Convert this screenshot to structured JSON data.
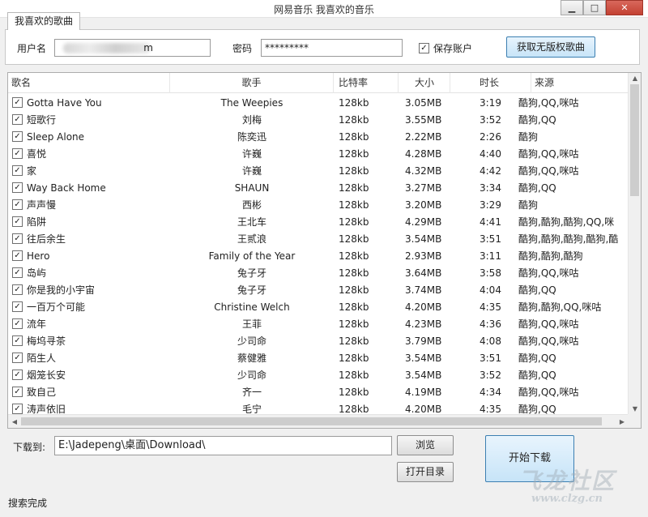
{
  "window": {
    "title": "网易音乐 我喜欢的音乐",
    "minimize_glyph": "▁",
    "maximize_glyph": "□",
    "close_glyph": "✕"
  },
  "tab": {
    "label": "我喜欢的歌曲"
  },
  "login": {
    "username_label": "用户名",
    "username_value_suffix": "m",
    "password_label": "密码",
    "password_value": "*********",
    "save_account_label": "保存账户",
    "save_account_checked": true,
    "fetch_button": "获取无版权歌曲"
  },
  "table": {
    "headers": [
      "歌名",
      "歌手",
      "比特率",
      "大小",
      "时长",
      "来源"
    ],
    "rows": [
      {
        "title": "Gotta Have You",
        "artist": "The Weepies",
        "bitrate": "128kb",
        "size": "3.05MB",
        "duration": "3:19",
        "source": "酷狗,QQ,咪咕"
      },
      {
        "title": "短歌行",
        "artist": "刘梅",
        "bitrate": "128kb",
        "size": "3.55MB",
        "duration": "3:52",
        "source": "酷狗,QQ"
      },
      {
        "title": "Sleep Alone",
        "artist": "陈奕迅",
        "bitrate": "128kb",
        "size": "2.22MB",
        "duration": "2:26",
        "source": "酷狗"
      },
      {
        "title": "喜悦",
        "artist": "许巍",
        "bitrate": "128kb",
        "size": "4.28MB",
        "duration": "4:40",
        "source": "酷狗,QQ,咪咕"
      },
      {
        "title": "家",
        "artist": "许巍",
        "bitrate": "128kb",
        "size": "4.32MB",
        "duration": "4:42",
        "source": "酷狗,QQ,咪咕"
      },
      {
        "title": "Way Back Home",
        "artist": "SHAUN",
        "bitrate": "128kb",
        "size": "3.27MB",
        "duration": "3:34",
        "source": "酷狗,QQ"
      },
      {
        "title": "声声慢",
        "artist": "西彬",
        "bitrate": "128kb",
        "size": "3.20MB",
        "duration": "3:29",
        "source": "酷狗"
      },
      {
        "title": "陷阱",
        "artist": "王北车",
        "bitrate": "128kb",
        "size": "4.29MB",
        "duration": "4:41",
        "source": "酷狗,酷狗,酷狗,QQ,咪"
      },
      {
        "title": "往后余生",
        "artist": "王贰浪",
        "bitrate": "128kb",
        "size": "3.54MB",
        "duration": "3:51",
        "source": "酷狗,酷狗,酷狗,酷狗,酷"
      },
      {
        "title": "Hero",
        "artist": "Family of the Year",
        "bitrate": "128kb",
        "size": "2.93MB",
        "duration": "3:11",
        "source": "酷狗,酷狗,酷狗"
      },
      {
        "title": "岛屿",
        "artist": "兔子牙",
        "bitrate": "128kb",
        "size": "3.64MB",
        "duration": "3:58",
        "source": "酷狗,QQ,咪咕"
      },
      {
        "title": "你是我的小宇宙",
        "artist": "兔子牙",
        "bitrate": "128kb",
        "size": "3.74MB",
        "duration": "4:04",
        "source": "酷狗,QQ"
      },
      {
        "title": "一百万个可能",
        "artist": "Christine Welch",
        "bitrate": "128kb",
        "size": "4.20MB",
        "duration": "4:35",
        "source": "酷狗,酷狗,QQ,咪咕"
      },
      {
        "title": "流年",
        "artist": "王菲",
        "bitrate": "128kb",
        "size": "4.23MB",
        "duration": "4:36",
        "source": "酷狗,QQ,咪咕"
      },
      {
        "title": "梅坞寻茶",
        "artist": "少司命",
        "bitrate": "128kb",
        "size": "3.79MB",
        "duration": "4:08",
        "source": "酷狗,QQ,咪咕"
      },
      {
        "title": "陌生人",
        "artist": "蔡健雅",
        "bitrate": "128kb",
        "size": "3.54MB",
        "duration": "3:51",
        "source": "酷狗,QQ"
      },
      {
        "title": "烟笼长安",
        "artist": "少司命",
        "bitrate": "128kb",
        "size": "3.54MB",
        "duration": "3:52",
        "source": "酷狗,QQ"
      },
      {
        "title": "致自己",
        "artist": "齐一",
        "bitrate": "128kb",
        "size": "4.19MB",
        "duration": "4:34",
        "source": "酷狗,QQ,咪咕"
      },
      {
        "title": "涛声依旧",
        "artist": "毛宁",
        "bitrate": "128kb",
        "size": "4.20MB",
        "duration": "4:35",
        "source": "酷狗,QQ"
      }
    ]
  },
  "download": {
    "label": "下载到:",
    "path": "E:\\Jadepeng\\桌面\\Download\\",
    "browse_button": "浏览",
    "open_dir_button": "打开目录",
    "start_button": "开始下载"
  },
  "status": {
    "text": "搜索完成"
  },
  "watermark": {
    "text": "飞龙社区",
    "url": "www.clzg.cn"
  },
  "icons": {
    "check": "✓",
    "up": "▲",
    "down": "▼",
    "left": "◀",
    "right": "▶"
  }
}
